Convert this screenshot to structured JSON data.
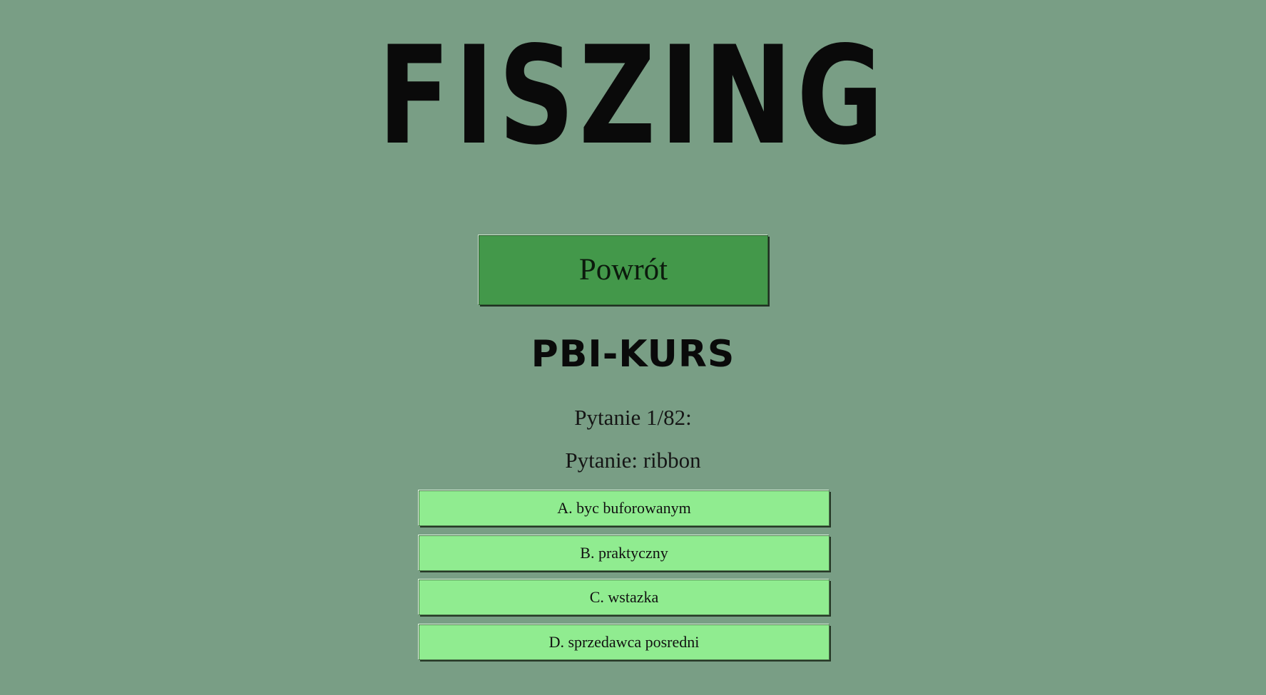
{
  "logo": {
    "text": "FISZING"
  },
  "nav": {
    "back_label": "Powrót"
  },
  "course": {
    "title": "PBI-KURS"
  },
  "quiz": {
    "counter_text": "Pytanie 1/82:",
    "question_text": "Pytanie: ribbon",
    "answers": [
      {
        "label": "A. byc buforowanym"
      },
      {
        "label": "B. praktyczny"
      },
      {
        "label": "C. wstazka"
      },
      {
        "label": "D. sprzedawca posredni"
      }
    ]
  },
  "colors": {
    "background": "#799e85",
    "back_button": "#43984a",
    "answer_button": "#90ec90"
  }
}
